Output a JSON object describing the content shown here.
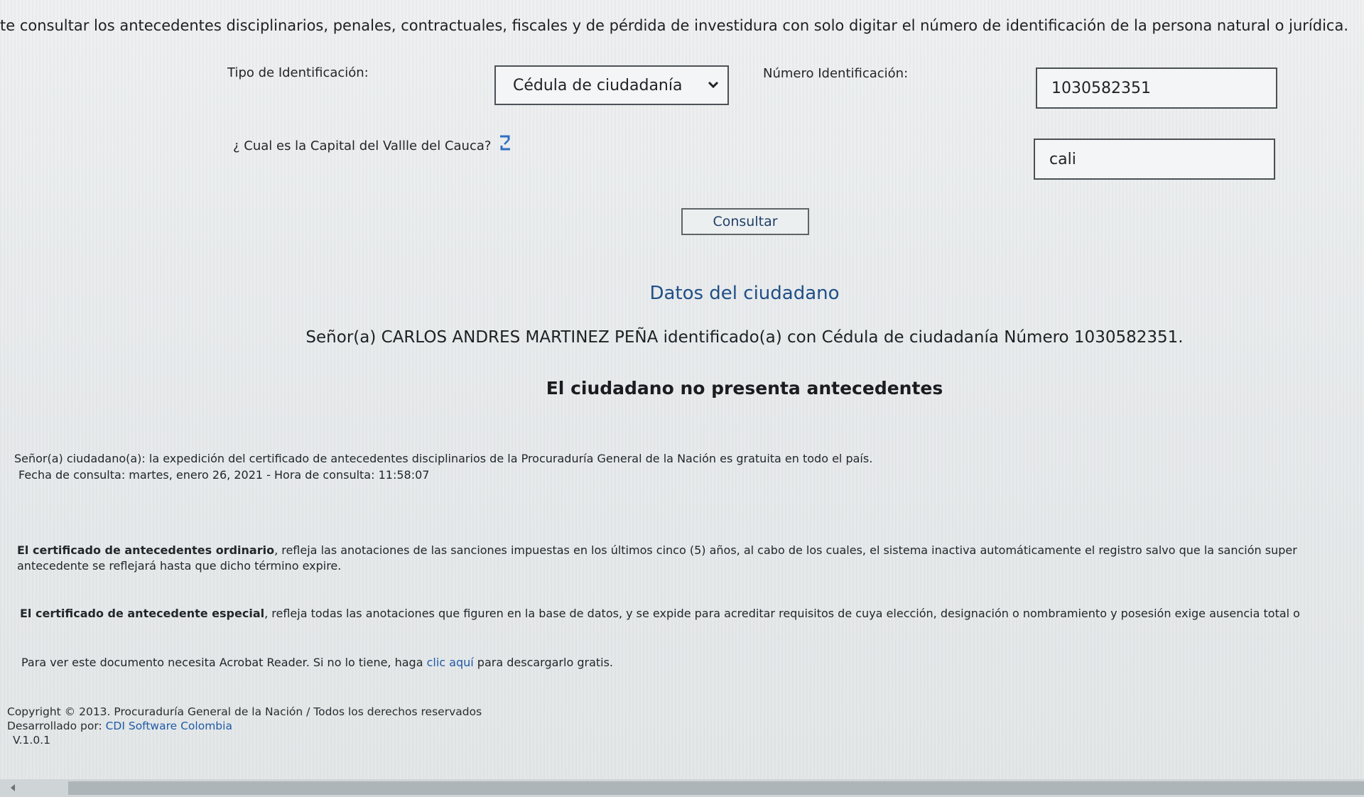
{
  "intro_text": "te consultar los antecedentes disciplinarios, penales, contractuales, fiscales y de pérdida de investidura con solo digitar el número de identificación de la persona natural o jurídica.",
  "form": {
    "tipo_label": "Tipo de Identificación:",
    "tipo_value": "Cédula de ciudadanía",
    "numero_label": "Número Identificación:",
    "numero_value": "1030582351",
    "pregunta_label": "¿ Cual es la Capital del Vallle del Cauca?",
    "respuesta_value": "cali",
    "consultar_label": "Consultar"
  },
  "result": {
    "title": "Datos del ciudadano",
    "citizen_line": "Señor(a)  CARLOS ANDRES MARTINEZ PEÑA identificado(a) con Cédula de ciudadanía Número 1030582351.",
    "status": "El ciudadano no presenta antecedentes"
  },
  "notes": {
    "free_notice": "Señor(a) ciudadano(a): la expedición del certificado de antecedentes disciplinarios de la Procuraduría General de la Nación es gratuita en todo el país.",
    "query_date": "Fecha de consulta: martes, enero 26, 2021 - Hora de consulta: 11:58:07",
    "ordinary_bold": "El certificado de antecedentes ordinario",
    "ordinary_rest": ", refleja las anotaciones de las sanciones impuestas en los últimos cinco (5) años, al cabo de los cuales, el sistema inactiva automáticamente el registro salvo que la sanción super",
    "ordinary_line2": "antecedente se reflejará hasta que dicho término expire.",
    "special_bold": "El certificado de antecedente especial",
    "special_rest": ", refleja todas las anotaciones que figuren en la base de datos, y se expide para acreditar requisitos de cuya elección, designación o nombramiento y posesión exige ausencia total o",
    "acrobat_before": "Para ver este documento necesita Acrobat Reader. Si no lo tiene, haga ",
    "acrobat_link": "clic aquí",
    "acrobat_after": " para descargarlo gratis."
  },
  "footer": {
    "copyright": "Copyright © 2013. Procuraduría General de la Nación / Todos los derechos reservados",
    "developed_prefix": "Desarrollado por: ",
    "developed_link": "CDI Software Colombia",
    "version": "V.1.0.1"
  },
  "icons": {
    "dropdown": "chevron-down-icon",
    "captcha_refresh": "refresh-icon",
    "scroll_left": "arrow-left-icon"
  },
  "colors": {
    "title_blue": "#1f4f86",
    "link_blue": "#1f5aa6",
    "refresh_blue": "#2f6fc2"
  }
}
